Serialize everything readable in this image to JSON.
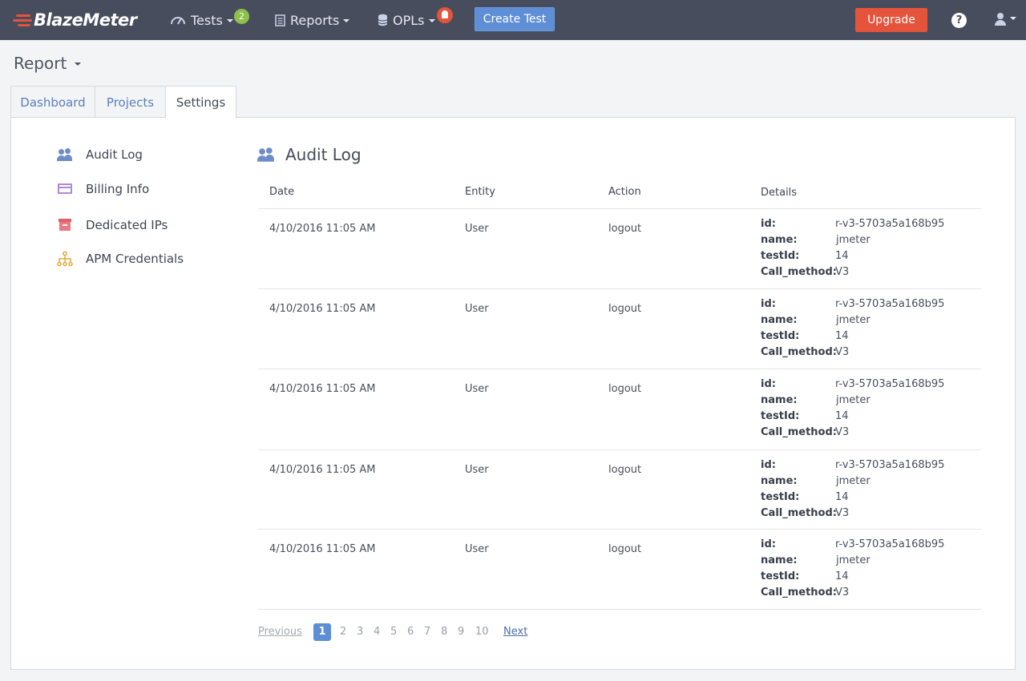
{
  "navbar": {
    "brand": "BlazeMeter",
    "tests_label": "Tests",
    "tests_badge": "2",
    "reports_label": "Reports",
    "opls_label": "OPLs",
    "create_test_label": "Create Test",
    "upgrade_label": "Upgrade",
    "help_label": "?"
  },
  "page": {
    "title": "Report"
  },
  "tabs": [
    {
      "label": "Dashboard"
    },
    {
      "label": "Projects"
    },
    {
      "label": "Settings",
      "active": true
    }
  ],
  "sidebar": {
    "items": [
      {
        "label": "Audit Log",
        "icon": "users-icon"
      },
      {
        "label": "Billing Info",
        "icon": "credit-card-icon"
      },
      {
        "label": "Dedicated IPs",
        "icon": "archive-box-icon"
      },
      {
        "label": "APM Credentials",
        "icon": "sitemap-icon"
      }
    ]
  },
  "audit": {
    "title": "Audit Log",
    "columns": {
      "date": "Date",
      "entity": "Entity",
      "action": "Action",
      "details": "Details"
    },
    "detail_keys": {
      "id": "id:",
      "name": "name:",
      "testId": "testId:",
      "call_method": "Call_method:"
    },
    "rows": [
      {
        "date": "4/10/2016 11:05 AM",
        "entity": "User",
        "action": "logout",
        "id": "r-v3-5703a5a168b95",
        "name": "jmeter",
        "testId": "14",
        "call_method": "V3"
      },
      {
        "date": "4/10/2016 11:05 AM",
        "entity": "User",
        "action": "logout",
        "id": "r-v3-5703a5a168b95",
        "name": "jmeter",
        "testId": "14",
        "call_method": "V3"
      },
      {
        "date": "4/10/2016 11:05 AM",
        "entity": "User",
        "action": "logout",
        "id": "r-v3-5703a5a168b95",
        "name": "jmeter",
        "testId": "14",
        "call_method": "V3"
      },
      {
        "date": "4/10/2016 11:05 AM",
        "entity": "User",
        "action": "logout",
        "id": "r-v3-5703a5a168b95",
        "name": "jmeter",
        "testId": "14",
        "call_method": "V3"
      },
      {
        "date": "4/10/2016 11:05 AM",
        "entity": "User",
        "action": "logout",
        "id": "r-v3-5703a5a168b95",
        "name": "jmeter",
        "testId": "14",
        "call_method": "V3"
      }
    ]
  },
  "pagination": {
    "previous": "Previous",
    "next": "Next",
    "current": "1",
    "pages": [
      "2",
      "3",
      "4",
      "5",
      "6",
      "7",
      "8",
      "9",
      "10"
    ]
  },
  "colors": {
    "navbar": "#484d5d",
    "accent_blue": "#5e8fd6",
    "upgrade_red": "#e5533b",
    "badge_green": "#8cc14c"
  }
}
